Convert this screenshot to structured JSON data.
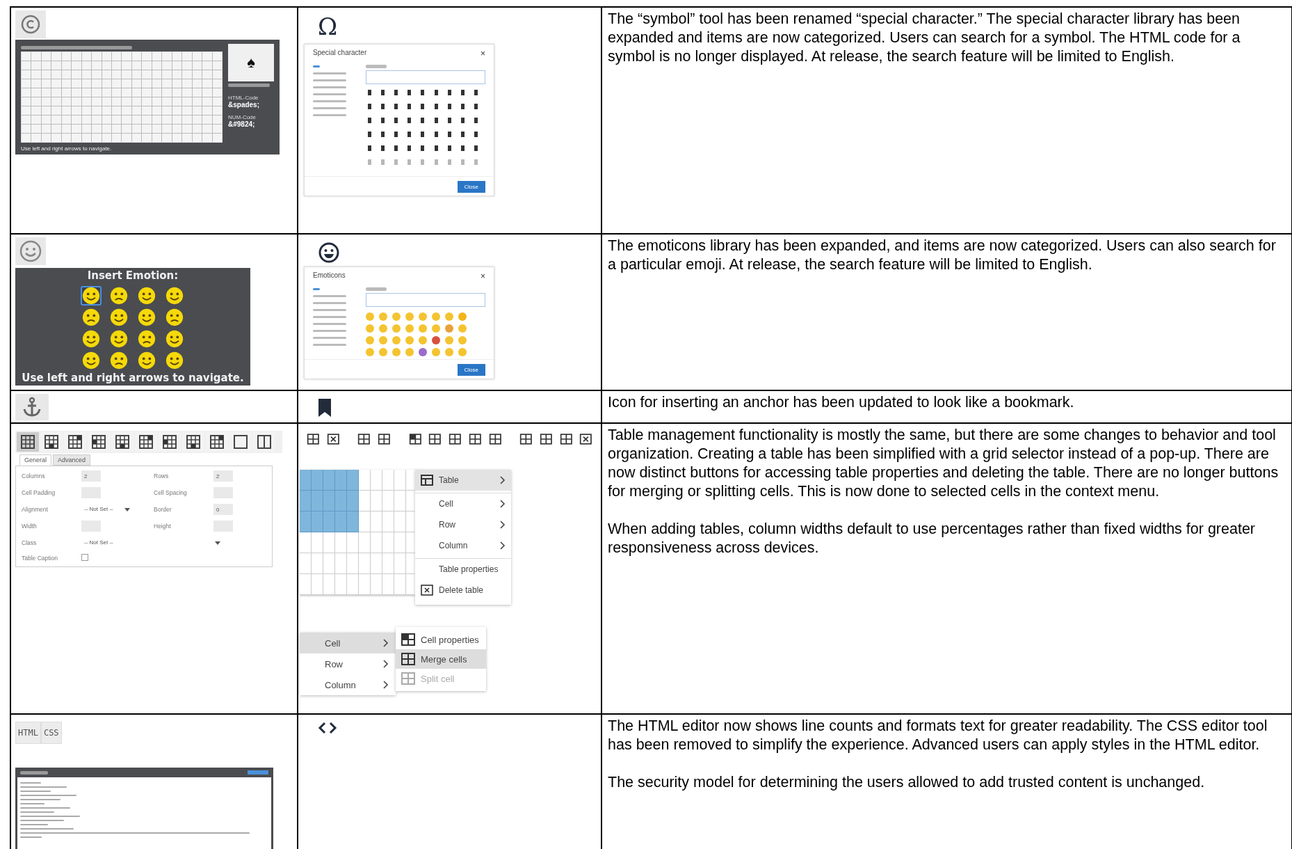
{
  "rows": [
    {
      "kind": "special_character",
      "old": {
        "preview_symbol": "♠",
        "html_label": "HTML-Code",
        "html_code": "&spades;",
        "num_label": "NUM-Code",
        "num_code": "&#9824;",
        "hint": "Use left and right arrows to navigate."
      },
      "new": {
        "icon": "Ω",
        "dialog_title": "Special character",
        "close_glyph": "×",
        "button": "Close"
      },
      "notes": [
        "The “symbol” tool has been renamed “special character.” The special character library has been expanded and items are now categorized. Users can search for a symbol.  The HTML code for a symbol is no longer displayed. At release, the search feature will be limited to English."
      ]
    },
    {
      "kind": "emoticons",
      "old": {
        "title": "Insert Emotion:",
        "hint": "Use left and right arrows to navigate.",
        "emojis": [
          {
            "selected": true
          },
          {
            "selected": false
          },
          {
            "selected": false
          },
          {
            "selected": false
          },
          {
            "selected": false
          },
          {
            "selected": false
          },
          {
            "selected": false
          },
          {
            "selected": false
          },
          {
            "selected": false
          },
          {
            "selected": false
          },
          {
            "selected": false
          },
          {
            "selected": false
          },
          {
            "selected": false
          },
          {
            "selected": false
          },
          {
            "selected": false
          },
          {
            "selected": false
          }
        ]
      },
      "new": {
        "dialog_title": "Emoticons",
        "close_glyph": "×",
        "button": "Close"
      },
      "notes": [
        "The emoticons library has been expanded, and items are now categorized. Users can also search for a particular emoji. At release, the search feature will be limited to English."
      ]
    },
    {
      "kind": "anchor",
      "notes": [
        "Icon for inserting an anchor has been updated to look like a bookmark."
      ]
    },
    {
      "kind": "table",
      "old": {
        "toolbar": [
          {
            "selected": true
          },
          {
            "selected": false
          },
          {
            "selected": false
          },
          {
            "selected": false
          },
          {
            "selected": false
          },
          {
            "selected": false
          },
          {
            "selected": false
          },
          {
            "selected": false
          },
          {
            "selected": false
          },
          {
            "selected": false
          },
          {
            "selected": false
          }
        ],
        "tabs": [
          {
            "label": "General",
            "selected": true
          },
          {
            "label": "Advanced",
            "selected": false
          }
        ],
        "fields": [
          {
            "label": "Columns",
            "kind": "text",
            "value": "2"
          },
          {
            "label": "Rows",
            "kind": "text",
            "value": "2"
          },
          {
            "label": "Cell Padding",
            "kind": "text"
          },
          {
            "label": "Cell Spacing",
            "kind": "text"
          },
          {
            "label": "Alignment",
            "kind": "select",
            "value": "-- Not Set --"
          },
          {
            "label": "Border",
            "kind": "text",
            "value": "0"
          },
          {
            "label": "Width",
            "kind": "text"
          },
          {
            "label": "Height",
            "kind": "text"
          },
          {
            "label": "Class",
            "kind": "wide_select",
            "value": "-- Not Set --"
          },
          {
            "label": "Table Caption",
            "kind": "checkbox",
            "checked": false
          }
        ]
      },
      "new": {
        "menu": [
          {
            "label": "Table",
            "kind": "icon_submenu",
            "selected": true,
            "separated": false
          },
          {
            "label": "Cell",
            "kind": "submenu",
            "selected": false,
            "separated": true
          },
          {
            "label": "Row",
            "kind": "submenu",
            "selected": false,
            "separated": false
          },
          {
            "label": "Column",
            "kind": "submenu",
            "selected": false,
            "separated": false
          },
          {
            "label": "Table properties",
            "kind": "item",
            "selected": false,
            "separated": true
          },
          {
            "label": "Delete table",
            "kind": "icon_item",
            "selected": false,
            "separated": false
          }
        ],
        "context_menu": [
          {
            "label": "Cell",
            "selected": true
          },
          {
            "label": "Row",
            "selected": false
          },
          {
            "label": "Column",
            "selected": false
          }
        ],
        "submenu": [
          {
            "label": "Cell properties",
            "selected": false,
            "disabled": false
          },
          {
            "label": "Merge cells",
            "selected": true,
            "disabled": false
          },
          {
            "label": "Split cell",
            "selected": false,
            "disabled": true
          }
        ]
      },
      "notes": [
        "Table management functionality is mostly the same, but there are some changes to behavior and tool organization. Creating a table has been simplified with a grid selector instead of a pop-up. There are now distinct buttons for accessing table properties and deleting the table. There are no longer buttons for merging or splitting cells. This is now done to selected cells in the context menu.",
        "When adding tables, column widths default to use percentages rather than fixed widths for greater responsiveness across devices."
      ]
    },
    {
      "kind": "html",
      "old": {
        "buttons": [
          "HTML",
          "CSS"
        ]
      },
      "notes": [
        "The HTML editor now shows line counts and formats text for greater readability. The CSS editor tool has been removed to simplify the experience. Advanced users can apply styles in the HTML editor.",
        "The security model for determining the users allowed to add trusted content is unchanged."
      ]
    }
  ]
}
